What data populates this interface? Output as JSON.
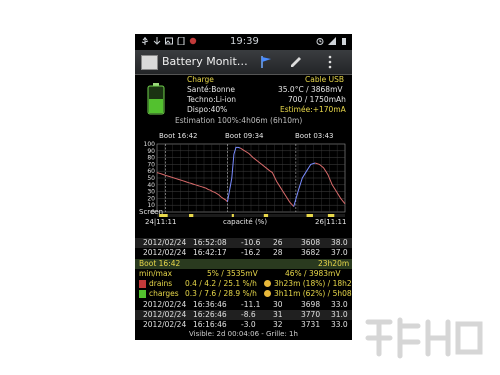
{
  "status_bar": {
    "time": "19:39"
  },
  "app": {
    "title": "Battery Monit…"
  },
  "info": {
    "charge": "Charge",
    "cable": "Cable USB",
    "sante": "Santé:Bonne",
    "sante_value": "35.0°C / 3868mV",
    "techno": "Techno:Li-ion",
    "techno_value": "700 / 1750mAh",
    "dispo": "Dispo:40%",
    "dispo_value": "Estimée:+170mA",
    "estimation": "Estimation 100%:4h06m (6h10m)"
  },
  "chart": {
    "boot_labels": [
      "Boot 16:42",
      "Boot 09:34",
      "Boot 03:43"
    ],
    "y_ticks": [
      "100",
      "90",
      "80",
      "70",
      "60",
      "50",
      "40",
      "30",
      "20",
      "10",
      "0"
    ],
    "screen_label": "Screen",
    "x_left": "24|11:11",
    "x_center": "capacité (%)",
    "x_right": "26|11:11"
  },
  "chart_data": {
    "type": "line",
    "ylabel": "capacité (%)",
    "ylim": [
      0,
      100
    ],
    "series": [
      {
        "x": [
          0,
          2,
          4,
          6,
          8,
          10,
          12,
          14,
          16,
          18,
          20,
          22,
          24,
          26,
          28,
          30,
          32,
          34,
          36,
          38,
          40
        ],
        "values": [
          58,
          57,
          56,
          55,
          54,
          53,
          52,
          51,
          50,
          49,
          48,
          47,
          46,
          45,
          44,
          43,
          42,
          41,
          40,
          39,
          38
        ]
      },
      {
        "x": [
          40,
          42,
          44,
          46,
          48,
          50,
          52,
          54,
          56,
          58,
          60,
          62,
          64,
          66
        ],
        "values": [
          38,
          37,
          36,
          35,
          33,
          32,
          30,
          29,
          27,
          25,
          22,
          20,
          18,
          15
        ]
      },
      {
        "x": [
          66,
          70,
          72,
          74,
          76,
          78
        ],
        "values": [
          15,
          50,
          85,
          95,
          95,
          94
        ]
      },
      {
        "x": [
          78,
          82,
          86,
          90,
          94,
          98,
          102,
          106,
          108,
          112,
          116,
          120,
          124,
          128
        ],
        "values": [
          94,
          90,
          86,
          80,
          75,
          70,
          65,
          60,
          58,
          45,
          35,
          25,
          15,
          8
        ]
      },
      {
        "x": [
          128,
          132,
          136,
          140,
          144,
          148
        ],
        "values": [
          8,
          30,
          50,
          60,
          70,
          72
        ]
      },
      {
        "x": [
          148,
          152,
          156,
          160,
          164,
          168,
          172,
          176
        ],
        "values": [
          72,
          70,
          65,
          55,
          40,
          30,
          20,
          12
        ]
      }
    ]
  },
  "log": {
    "rows_top": [
      [
        "2012/02/24",
        "17:02:08",
        "-9.0",
        "25",
        "3746",
        "30.0"
      ],
      [
        "2012/02/24",
        "16:52:08",
        "-10.6",
        "26",
        "3608",
        "38.0"
      ],
      [
        "2012/02/24",
        "16:42:17",
        "-16.2",
        "28",
        "3682",
        "37.0"
      ]
    ],
    "boot": "Boot 16:42",
    "boot_right": "23h20m",
    "minmax": "min/max",
    "minmax_mid": "5% / 3535mV",
    "minmax_right": "46% / 3983mV",
    "drains": "drains",
    "drains_mid": "0.4 / 4.2 / 25.1 %/h",
    "drains_right": "3h23m (18%) / 18h20m",
    "charges": "charges",
    "charges_mid": "0.3 / 7.6 / 28.9 %/h",
    "charges_right": "3h11m (62%) / 5h08m",
    "rows_bottom": [
      [
        "2012/02/24",
        "16:36:46",
        "-11.1",
        "30",
        "3698",
        "33.0"
      ],
      [
        "2012/02/24",
        "16:26:46",
        "-8.6",
        "31",
        "3770",
        "31.0"
      ],
      [
        "2012/02/24",
        "16:16:46",
        "-3.0",
        "32",
        "3731",
        "33.0"
      ]
    ],
    "visible": "Visible: 2d 00:04:06 - Grille: 1h"
  },
  "colors": {
    "bg": "#000000",
    "yellow": "#e8d84a",
    "green": "#6fd04b",
    "battery": "#53c12f"
  }
}
